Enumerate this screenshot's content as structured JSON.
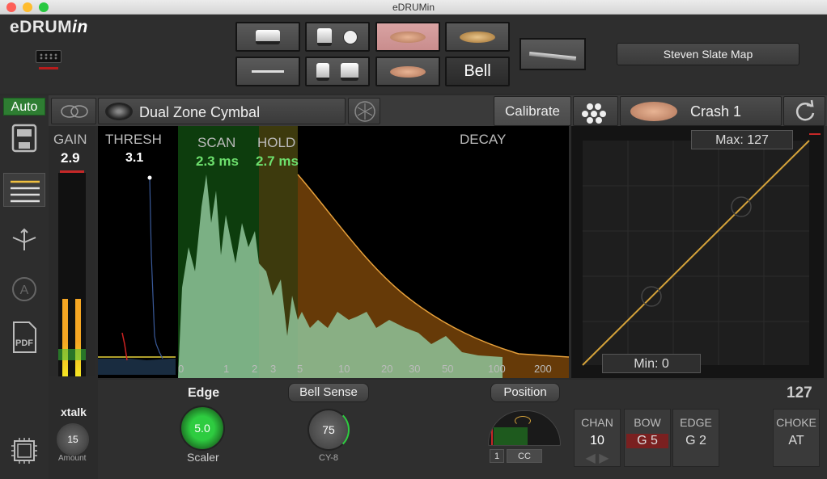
{
  "window": {
    "title": "eDRUMin"
  },
  "logo": {
    "text_plain": "eDRUM",
    "text_italic": "in"
  },
  "pads": {
    "bell_label": "Bell"
  },
  "map_button": "Steven Slate Map",
  "auto_label": "Auto",
  "zone": {
    "name": "Dual Zone Cymbal",
    "calibrate": "Calibrate",
    "sound": "Crash 1"
  },
  "gain": {
    "label": "GAIN",
    "value": "2.9"
  },
  "thresh": {
    "label": "THRESH",
    "value": "3.1"
  },
  "scan": {
    "label": "SCAN",
    "value": "2.3 ms"
  },
  "hold": {
    "label": "HOLD",
    "value": "2.7 ms"
  },
  "decay": {
    "label": "DECAY"
  },
  "ticks": [
    "0",
    "1",
    "2",
    "3",
    "5",
    "10",
    "20",
    "30",
    "50",
    "100",
    "200"
  ],
  "curve": {
    "max": "Max: 127",
    "min": "Min: 0"
  },
  "xtalk": {
    "label": "xtalk",
    "value": "15",
    "sub": "Amount"
  },
  "edge": {
    "label": "Edge",
    "value": "5.0",
    "sub": "Scaler"
  },
  "bell_sense": {
    "label": "Bell Sense",
    "value": "75",
    "sub": "CY-8"
  },
  "position": {
    "label": "Position",
    "num": "1",
    "mode": "CC"
  },
  "velocity": "127",
  "midi": {
    "chan_label": "CHAN",
    "chan": "10",
    "bow_label": "BOW",
    "bow": "G 5",
    "edge_label": "EDGE",
    "edge": "G 2",
    "choke_label": "CHOKE",
    "choke": "AT"
  },
  "colors": {
    "accent_green": "#2e7d32",
    "selected_pad": "#d29a9a",
    "curve": "#d4a23a"
  }
}
